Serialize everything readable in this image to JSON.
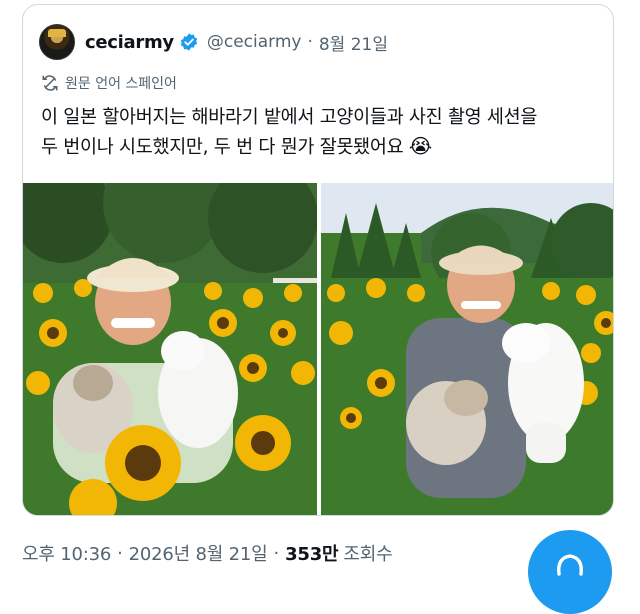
{
  "tweet": {
    "display_name": "ceciarmy",
    "handle": "@ceciarmy",
    "separator": "·",
    "date": "8월 21일",
    "translate_note": "원문 언어 스페인어",
    "text_line1": "이 일본 할아버지는 해바라기 밭에서 고양이들과 사진 촬영 세션을",
    "text_line2": "두 번이나 시도했지만, 두 번 다 뭔가 잘못됐어요",
    "emoji": "😭",
    "images": [
      "photo-1",
      "photo-2"
    ]
  },
  "footer": {
    "time": "오후 10:36",
    "separator": "·",
    "date": "2026년 8월 21일",
    "views_count": "353만",
    "views_label": "조회수"
  },
  "icons": {
    "verified": "verified-badge-icon",
    "translate": "translate-icon",
    "fab": "compose-icon"
  },
  "colors": {
    "accent": "#1d9bf0",
    "secondary_text": "#536471",
    "border": "#cfd9de"
  }
}
